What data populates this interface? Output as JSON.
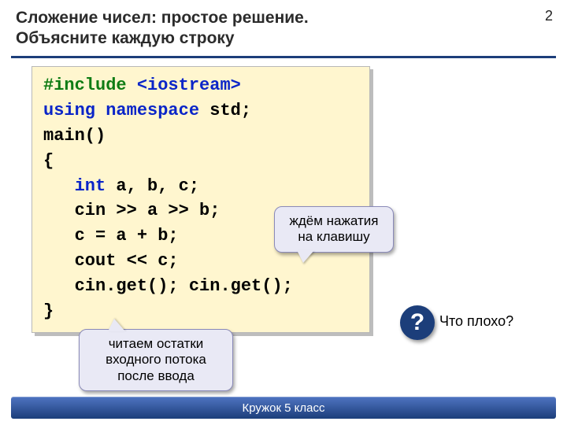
{
  "title_line1": "Сложение чисел: простое решение.",
  "title_line2": "Объясните каждую строку",
  "page_number": "2",
  "code": {
    "include_kw": "#include",
    "include_hdr": " <iostream>",
    "using_kw": "using",
    "namespace_kw": " namespace",
    "std_txt": " std;",
    "main": "main()",
    "lbrace": "{",
    "indent": "   ",
    "int_kw": "int",
    "vars": " a, b, c;",
    "cin_line": "cin >> a >> b;",
    "assign_line": "c = a + b;",
    "cout_line": "cout << c;",
    "get_line": "cin.get(); cin.get();",
    "rbrace": "}"
  },
  "callouts": {
    "wait": "ждём нажатия на клавишу",
    "read": "читаем остатки входного потока после ввода"
  },
  "question_mark": "?",
  "question_text": "Что плохо?",
  "footer": "Кружок 5 класс"
}
